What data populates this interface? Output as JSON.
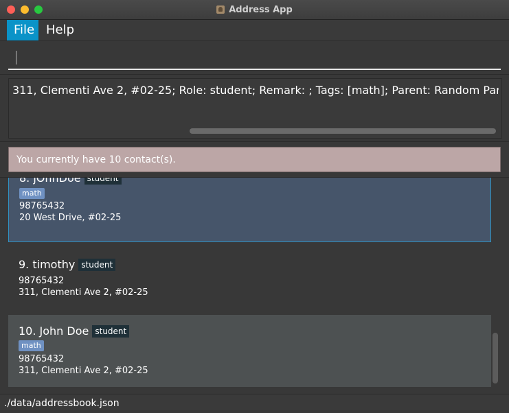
{
  "window": {
    "title": "Address App"
  },
  "menu": {
    "file": "File",
    "help": "Help"
  },
  "command_box": {
    "value": ""
  },
  "result_display": {
    "text": "311, Clementi Ave 2, #02-25; Role: student; Remark: ; Tags: [math]; Parent: Random Parent Name"
  },
  "status_message": "You currently have 10 contact(s).",
  "contacts": [
    {
      "name": "8. jOhnDoe",
      "role": "student",
      "tag": "math",
      "phone": "98765432",
      "address": "20 West Drive, #02-25",
      "selected": true
    },
    {
      "name": "9. timothy",
      "role": "student",
      "tag": "",
      "phone": "98765432",
      "address": "311, Clementi Ave 2, #02-25",
      "selected": false
    },
    {
      "name": "10. John Doe",
      "role": "student",
      "tag": "math",
      "phone": "98765432",
      "address": "311, Clementi Ave 2, #02-25",
      "selected": false
    }
  ],
  "footer": {
    "path": "./data/addressbook.json"
  },
  "colors": {
    "accent": "#0a93c8",
    "selected_border": "#2f93c4",
    "status_bg": "#bca6a6",
    "tag_bg": "#6f91c2"
  }
}
